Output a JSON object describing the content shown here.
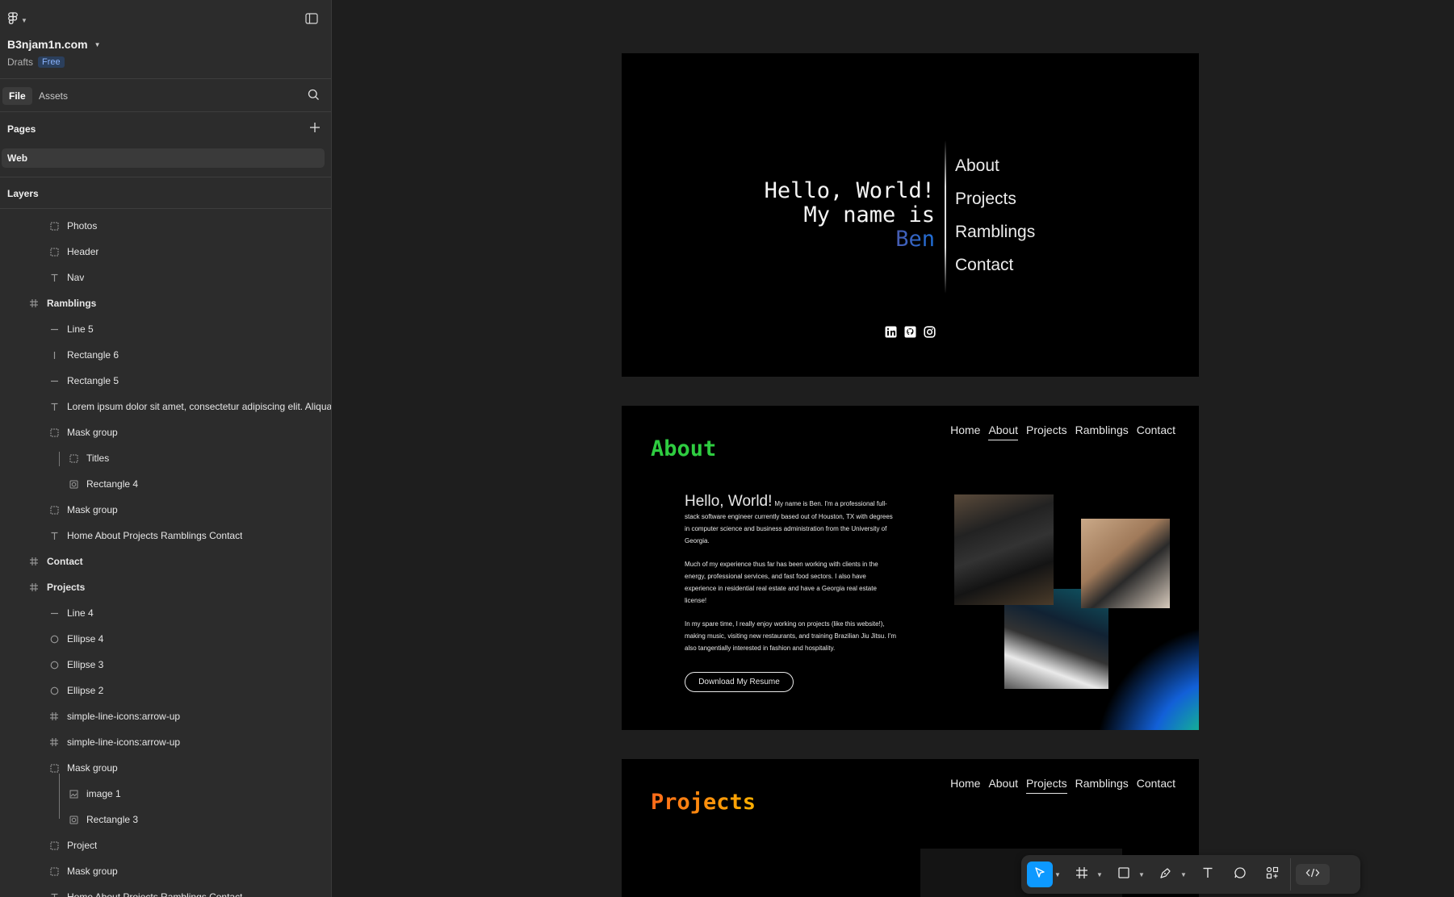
{
  "file": {
    "name": "B3njam1n.com",
    "location": "Drafts",
    "plan_badge": "Free"
  },
  "tabs": [
    {
      "label": "File"
    },
    {
      "label": "Assets"
    }
  ],
  "pages": {
    "header": "Pages",
    "items": [
      {
        "label": "Web"
      }
    ]
  },
  "layers": {
    "header": "Layers",
    "items": [
      {
        "label": "Photos",
        "icon": "group"
      },
      {
        "label": "Header",
        "icon": "group"
      },
      {
        "label": "Nav",
        "icon": "text"
      },
      {
        "label": "Ramblings",
        "icon": "frame"
      },
      {
        "label": "Line 5",
        "icon": "line"
      },
      {
        "label": "Rectangle 6",
        "icon": "vline"
      },
      {
        "label": "Rectangle 5",
        "icon": "line"
      },
      {
        "label": "Lorem ipsum dolor sit amet, consectetur adipiscing elit. Aliquam",
        "icon": "text"
      },
      {
        "label": "Mask group",
        "icon": "group"
      },
      {
        "label": "Titles",
        "icon": "group"
      },
      {
        "label": "Rectangle 4",
        "icon": "mask"
      },
      {
        "label": "Mask group",
        "icon": "group"
      },
      {
        "label": "Home About Projects Ramblings Contact",
        "icon": "text"
      },
      {
        "label": "Contact",
        "icon": "frame"
      },
      {
        "label": "Projects",
        "icon": "frame"
      },
      {
        "label": "Line 4",
        "icon": "line"
      },
      {
        "label": "Ellipse 4",
        "icon": "ellipse"
      },
      {
        "label": "Ellipse 3",
        "icon": "ellipse"
      },
      {
        "label": "Ellipse 2",
        "icon": "ellipse"
      },
      {
        "label": "simple-line-icons:arrow-up",
        "icon": "frame"
      },
      {
        "label": "simple-line-icons:arrow-up",
        "icon": "frame"
      },
      {
        "label": "Mask group",
        "icon": "group"
      },
      {
        "label": "image 1",
        "icon": "image"
      },
      {
        "label": "Rectangle 3",
        "icon": "mask"
      },
      {
        "label": "Project",
        "icon": "group"
      },
      {
        "label": "Mask group",
        "icon": "group"
      },
      {
        "label": "Home About Projects Ramblings Contact",
        "icon": "text"
      }
    ]
  },
  "hero": {
    "line1": "Hello, World!",
    "line2": "My name is",
    "name": "Ben",
    "nav": [
      "About",
      "Projects",
      "Ramblings",
      "Contact"
    ],
    "socials": [
      "linkedin-icon",
      "github-icon",
      "instagram-icon"
    ]
  },
  "about": {
    "title": "About",
    "nav": [
      "Home",
      "About",
      "Projects",
      "Ramblings",
      "Contact"
    ],
    "heading": "Hello, World!",
    "para1": "My name is Ben. I'm a professional full-stack software engineer currently based out of Houston, TX with degrees in computer science and business administration from the University of Georgia.",
    "para2": "Much of my experience thus far has been working with clients in the energy, professional services, and fast food sectors. I also have experience in residential real estate and have a Georgia real estate license!",
    "para3": "In my spare time, I really enjoy working on projects (like this website!), making music, visiting new restaurants, and training Brazilian Jiu Jitsu. I'm also tangentially interested in fashion and hospitality.",
    "button": "Download My Resume"
  },
  "projects": {
    "title": "Projects",
    "nav": [
      "Home",
      "About",
      "Projects",
      "Ramblings",
      "Contact"
    ]
  },
  "colors": {
    "accent": "#0d99ff",
    "about_title": "#2ecc40",
    "projects_title": "#ff8c1a",
    "canvas": "#1e1e1e",
    "sidebar": "#2c2c2c"
  }
}
